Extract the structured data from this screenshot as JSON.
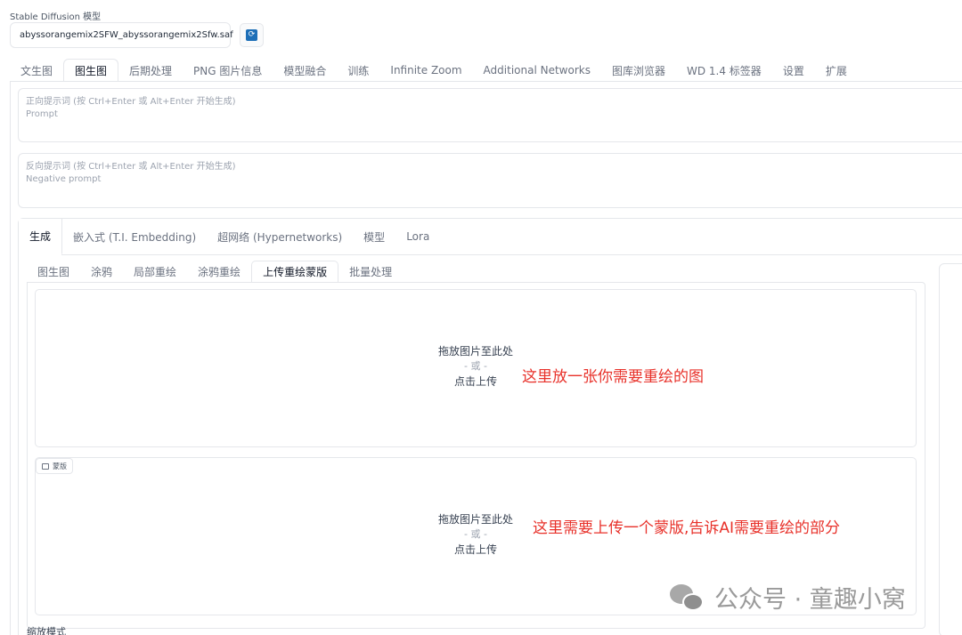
{
  "model": {
    "label": "Stable Diffusion 模型",
    "selected": "abyssorangemix2SFW_abyssorangemix2Sfw.saf"
  },
  "main_tabs": [
    {
      "label": "文生图"
    },
    {
      "label": "图生图",
      "active": true
    },
    {
      "label": "后期处理"
    },
    {
      "label": "PNG 图片信息"
    },
    {
      "label": "模型融合"
    },
    {
      "label": "训练"
    },
    {
      "label": "Infinite Zoom"
    },
    {
      "label": "Additional Networks"
    },
    {
      "label": "图库浏览器"
    },
    {
      "label": "WD 1.4 标签器"
    },
    {
      "label": "设置"
    },
    {
      "label": "扩展"
    }
  ],
  "prompt": {
    "placeholder_line1": "正向提示词 (按 Ctrl+Enter 或 Alt+Enter 开始生成)",
    "placeholder_line2": "Prompt"
  },
  "negative_prompt": {
    "placeholder_line1": "反向提示词 (按 Ctrl+Enter 或 Alt+Enter 开始生成)",
    "placeholder_line2": "Negative prompt"
  },
  "sub_tabs": [
    {
      "label": "生成",
      "active": true
    },
    {
      "label": "嵌入式 (T.I. Embedding)"
    },
    {
      "label": "超网络 (Hypernetworks)"
    },
    {
      "label": "模型"
    },
    {
      "label": "Lora"
    }
  ],
  "img_tabs": [
    {
      "label": "图生图"
    },
    {
      "label": "涂鸦"
    },
    {
      "label": "局部重绘"
    },
    {
      "label": "涂鸦重绘"
    },
    {
      "label": "上传重绘蒙版",
      "active": true
    },
    {
      "label": "批量处理"
    }
  ],
  "upload_image": {
    "line1": "拖放图片至此处",
    "line2": "- 或 -",
    "line3": "点击上传",
    "annotation": "这里放一张你需要重绘的图"
  },
  "upload_mask": {
    "chip_label": "蒙版",
    "line1": "拖放图片至此处",
    "line2": "- 或 -",
    "line3": "点击上传",
    "annotation": "这里需要上传一个蒙版,告诉AI需要重绘的部分"
  },
  "resize_mode_label": "缩放模式",
  "watermark": "公众号 · 童趣小窝",
  "colors": {
    "annotation": "#e8312a",
    "refresh_icon": "#1d6fb8"
  }
}
